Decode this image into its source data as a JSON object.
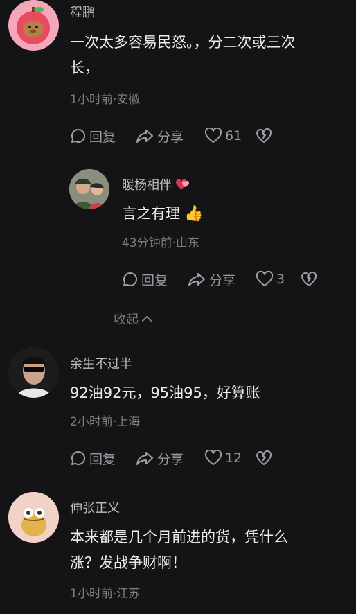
{
  "comments": [
    {
      "name": "程鹏",
      "text_lines": [
        "一次太多容易民怒。，分二次或三次",
        "长，"
      ],
      "meta": "1小时前·安徽",
      "reply_label": "回复",
      "share_label": "分享",
      "likes": "61"
    },
    {
      "name": "暖杨相伴",
      "text": "言之有理",
      "emoji": "👍",
      "meta": "43分钟前·山东",
      "reply_label": "回复",
      "share_label": "分享",
      "likes": "3"
    },
    {
      "name": "余生不过半",
      "text": "92油92元，95油95，好算账",
      "meta": "2小时前·上海",
      "reply_label": "回复",
      "share_label": "分享",
      "likes": "12"
    },
    {
      "name": "伸张正义",
      "text_lines": [
        "本来都是几个月前进的货，凭什么",
        "涨？发战争财啊！"
      ],
      "meta": "1小时前·江苏"
    }
  ],
  "collapse_label": "收起",
  "colors": {
    "background": "#141416",
    "muted": "#7f7f82",
    "text": "#ececec"
  }
}
